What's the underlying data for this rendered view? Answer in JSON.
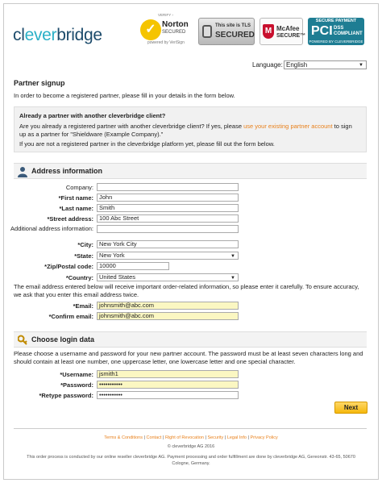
{
  "header": {
    "logo_prefix": "cl",
    "logo_mid": "ever",
    "logo_suffix": "bridge",
    "seals": {
      "norton_top": "VERIFY ›",
      "norton_name": "Norton",
      "norton_sub": "SECURED",
      "norton_by": "powered by VeriSign",
      "tls_line1": "This site is TLS",
      "tls_line2": "SECURED",
      "mcafee_line1": "McAfee",
      "mcafee_line2": "SECURE™",
      "pci_top": "SECURE PAYMENT",
      "pci_big": "PCI",
      "pci_dss": "DSS",
      "pci_compliant": "COMPLIANT",
      "pci_bottom": "POWERED BY CLEVERBRIDGE"
    }
  },
  "language": {
    "label": "Language:",
    "value": "English"
  },
  "page_title": "Partner signup",
  "intro": "In order to become a registered partner, please fill in your details in the form below.",
  "partner_box": {
    "title": "Already a partner with another cleverbridge client?",
    "text_before": "Are you already a registered partner with another cleverbridge client? If yes, please ",
    "link": "use your existing partner account",
    "text_after": " to sign up as a partner for \"Shieldware (Example Company).\"",
    "text2": "If you are not a registered partner in the cleverbridge platform yet, please fill out the form below."
  },
  "address": {
    "title": "Address information",
    "company_label": "Company:",
    "company_value": "",
    "first_name_label": "*First name:",
    "first_name_value": "John",
    "last_name_label": "*Last name:",
    "last_name_value": "Smith",
    "street_label": "*Street address:",
    "street_value": "100 Abc Street",
    "additional_label": "Additional address information:",
    "additional_value": "",
    "city_label": "*City:",
    "city_value": "New York City",
    "state_label": "*State:",
    "state_value": "New York",
    "zip_label": "*Zip/Postal code:",
    "zip_value": "10000",
    "country_label": "*Country:",
    "country_value": "United States"
  },
  "email_note": "The email address entered below will receive important order-related information, so please enter it carefully. To ensure accuracy, we ask that you enter this email address twice.",
  "email": {
    "email_label": "*Email:",
    "email_value": "johnsmith@abc.com",
    "confirm_label": "*Confirm email:",
    "confirm_value": "johnsmith@abc.com"
  },
  "login": {
    "title": "Choose login data",
    "note": "Please choose a username and password for your new partner account. The password must be at least seven characters long and should contain at least one number, one uppercase letter, one lowercase letter and one special character.",
    "username_label": "*Username:",
    "username_value": "jsmith1",
    "password_label": "*Password:",
    "password_value": "•••••••••••",
    "retype_label": "*Retype password:",
    "retype_value": "•••••••••••"
  },
  "next_label": "Next",
  "footer": {
    "links": [
      "Terms & Conditions",
      "Contact",
      "Right of Revocation",
      "Security",
      "Legal Info",
      "Privacy Policy"
    ],
    "separator": " | ",
    "copyright": "© cleverbridge AG 2016",
    "disclaimer": "This order process is conducted by our online reseller cleverbridge AG. Payment processing and order fulfillment are done by cleverbridge AG, Gereonstr. 43-65, 50670 Cologne, Germany."
  },
  "colors": {
    "accent": "#e8801b",
    "logo": "#1c4b6b",
    "logo_accent": "#2bb0c7",
    "button": "#f5b80d",
    "highlight": "#fbf7c2"
  }
}
